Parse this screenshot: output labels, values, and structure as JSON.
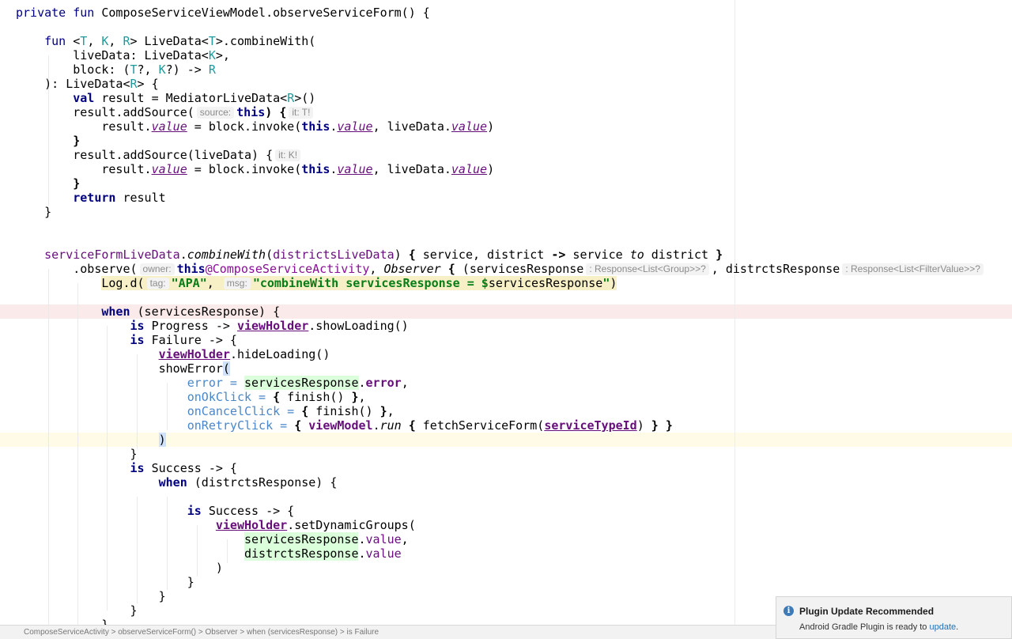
{
  "code": {
    "line1": {
      "k1": "private",
      "k2": "fun",
      "t": " ComposeServiceViewModel.observeServiceForm() {"
    },
    "line2": {
      "k": "fun",
      "tp1": "T",
      "tp2": "K",
      "tp3": "R",
      "t1": " LiveData<",
      "tp4": "T",
      "t2": ">.combineWith("
    },
    "line3": {
      "t": "liveData: LiveData<",
      "tp": "K",
      "t2": ">,"
    },
    "line4": {
      "t": "block: (",
      "tp1": "T",
      "t2": "?, ",
      "tp2": "K",
      "t3": "?) -> ",
      "tp3": "R"
    },
    "line5": {
      "t": "): LiveData<",
      "tp": "R",
      "t2": "> {"
    },
    "line6": {
      "k": "val",
      "t": " result = MediatorLiveData<",
      "tp": "R",
      "t2": ">()"
    },
    "line7": {
      "t": "result.addSource(",
      "hint1": "source:",
      "k": "this",
      "t2": ") {",
      "hint2": "it: T!"
    },
    "line8": {
      "t1": "result.",
      "p1": "value",
      "t2": " = block.invoke(",
      "k": "this",
      "t3": ".",
      "p2": "value",
      "t4": ", liveData.",
      "p3": "value",
      "t5": ")"
    },
    "line9": {
      "t": "}"
    },
    "line10": {
      "t": "result.addSource(liveData) {",
      "hint": "it: K!"
    },
    "line11": {
      "t1": "result.",
      "p1": "value",
      "t2": " = block.invoke(",
      "k": "this",
      "t3": ".",
      "p2": "value",
      "t4": ", liveData.",
      "p3": "value",
      "t5": ")"
    },
    "line12": {
      "t": "}"
    },
    "line13": {
      "k": "return",
      "t": " result"
    },
    "line14": {
      "t": "}"
    },
    "line15": {
      "p1": "serviceFormLiveData",
      "t1": ".",
      "f": "combineWith",
      "t2": "(",
      "p2": "districtsLiveData",
      "t3": ") ",
      "b1": "{",
      "t4": " service, district ",
      "b2": "->",
      "t5": " service ",
      "i": "to",
      "t6": " district ",
      "b3": "}"
    },
    "line16": {
      "t1": ".observe(",
      "hint1": "owner:",
      "k": "this",
      "lbl": "@ComposeServiceActivity",
      "t2": ", ",
      "i": "Observer",
      "t3": " ",
      "b": "{",
      "t4": " (servicesResponse",
      "hint2": ": Response<List<Group>>?",
      "t5": ", distrctsResponse",
      "hint3": ": Response<List<FilterValue>>?"
    },
    "line17": {
      "t1": "Log.d(",
      "hint1": "tag:",
      "s1": "\"APA\"",
      "t2": ", ",
      "hint2": "msg:",
      "s2": "\"combineWith servicesResponse = $",
      "t3": "servicesResponse",
      "s3": "\"",
      "t4": ")"
    },
    "line18": {
      "k": "when",
      "t": " (servicesResponse) {"
    },
    "line19": {
      "k": "is",
      "t1": " Progress -> ",
      "p": "viewHolder",
      "t2": ".showLoading()"
    },
    "line20": {
      "k": "is",
      "t": " Failure -> {"
    },
    "line21": {
      "p": "viewHolder",
      "t": ".hideLoading()"
    },
    "line22": {
      "t": "showError",
      "brc": "("
    },
    "line23": {
      "n": "error =",
      "t1": " ",
      "g": "servicesResponse",
      "t2": ".",
      "p": "error",
      "t3": ","
    },
    "line24": {
      "n": "onOkClick =",
      "t1": " ",
      "b1": "{",
      "t2": " finish() ",
      "b2": "}",
      "t3": ","
    },
    "line25": {
      "n": "onCancelClick =",
      "t1": " ",
      "b1": "{",
      "t2": " finish() ",
      "b2": "}",
      "t3": ","
    },
    "line26": {
      "n": "onRetryClick =",
      "t1": " ",
      "b1": "{",
      "t2": " ",
      "p1": "viewModel",
      "t3": ".",
      "f": "run",
      "t4": " ",
      "b2": "{",
      "t5": " fetchServiceForm(",
      "p2": "serviceTypeId",
      "t6": ") ",
      "b3": "}",
      "t7": " ",
      "b4": "}"
    },
    "line27": {
      "brc": ")"
    },
    "line28": {
      "t": "}"
    },
    "line29": {
      "k": "is",
      "t": " Success -> {"
    },
    "line30": {
      "k": "when",
      "t": " (distrctsResponse) {"
    },
    "line31": {
      "k": "is",
      "t": " Success -> {"
    },
    "line32": {
      "p": "viewHolder",
      "t": ".setDynamicGroups("
    },
    "line33": {
      "g": "servicesResponse",
      "t1": ".",
      "p": "value",
      "t2": ","
    },
    "line34": {
      "g": "distrctsResponse",
      "t1": ".",
      "p": "value"
    },
    "line35": {
      "t": ")"
    },
    "line36": {
      "t": "}"
    },
    "line37": {
      "t": "}"
    },
    "line38": {
      "t": "}"
    },
    "line39": {
      "t": "}"
    }
  },
  "status_bar": {
    "text": "ComposeServiceActivity  >  observeServiceForm()  >  Observer  >  when (servicesResponse)  >  is Failure"
  },
  "notification": {
    "title": "Plugin Update Recommended",
    "body_prefix": "Android Gradle Plugin is ready to ",
    "link": "update",
    "body_suffix": "."
  },
  "colors": {
    "keyword": "#000080",
    "type_param": "#20999d",
    "property": "#660e7a",
    "string": "#067d17",
    "named_arg": "#4a86c8",
    "link": "#2470b3"
  }
}
